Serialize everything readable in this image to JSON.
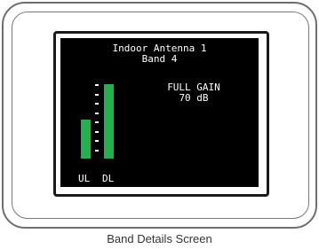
{
  "screen": {
    "antenna_name": "Indoor Antenna 1",
    "band": "Band 4",
    "gain_status": "FULL GAIN",
    "gain_value": "70 dB",
    "meter": {
      "ul_label": "UL",
      "dl_label": "DL",
      "ul_level": 0.5,
      "dl_level": 0.95,
      "bar_color": "#22b14c"
    }
  },
  "caption": "Band Details Screen"
}
